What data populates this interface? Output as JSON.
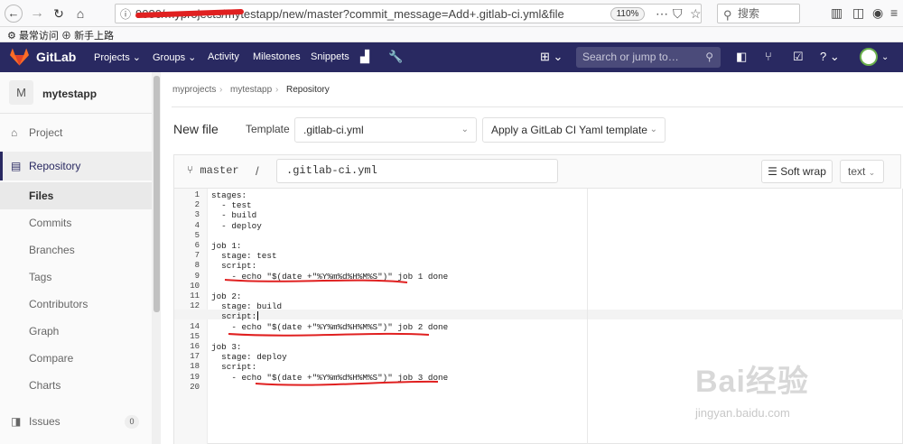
{
  "browser": {
    "url": "9080/myprojects/mytestapp/new/master?commit_message=Add+.gitlab-ci.yml&file",
    "zoom": "110%",
    "search_placeholder": "搜索",
    "bookmarks": [
      "最常访问",
      "新手上路"
    ]
  },
  "gitlab_nav": {
    "brand": "GitLab",
    "links": [
      "Projects ⌄",
      "Groups ⌄",
      "Activity",
      "Milestones",
      "Snippets"
    ],
    "search_placeholder": "Search or jump to…"
  },
  "sidebar": {
    "project_initial": "M",
    "project_name": "mytestapp",
    "items": [
      "Project",
      "Repository",
      "Files",
      "Commits",
      "Branches",
      "Tags",
      "Contributors",
      "Graph",
      "Compare",
      "Charts",
      "Issues"
    ],
    "issues_count": "0"
  },
  "breadcrumb": [
    "myprojects",
    "mytestapp",
    "Repository"
  ],
  "editor": {
    "title": "New file",
    "template_label": "Template",
    "template_value": ".gitlab-ci.yml",
    "apply_template": "Apply a GitLab CI Yaml template",
    "branch": "master",
    "path_sep": "/",
    "file_name": ".gitlab-ci.yml",
    "soft_wrap": "Soft wrap",
    "lang": "text",
    "lines": [
      "stages:",
      "  - test",
      "  - build",
      "  - deploy",
      "",
      "job 1:",
      "  stage: test",
      "  script:",
      "    - echo \"$(date +\"%Y%m%d%H%M%S\")\" job 1 done",
      "",
      "job 2:",
      "  stage: build",
      "  script:",
      "    - echo \"$(date +\"%Y%m%d%H%M%S\")\" job 2 done",
      "",
      "job 3:",
      "  stage: deploy",
      "  script:",
      "    - echo \"$(date +\"%Y%m%d%H%M%S\")\" job 3 done",
      ""
    ]
  },
  "watermark": {
    "line1": "Bai经验",
    "line2": "jingyan.baidu.com"
  },
  "colors": {
    "nav_bg": "#292961",
    "annotation": "#e02020"
  }
}
